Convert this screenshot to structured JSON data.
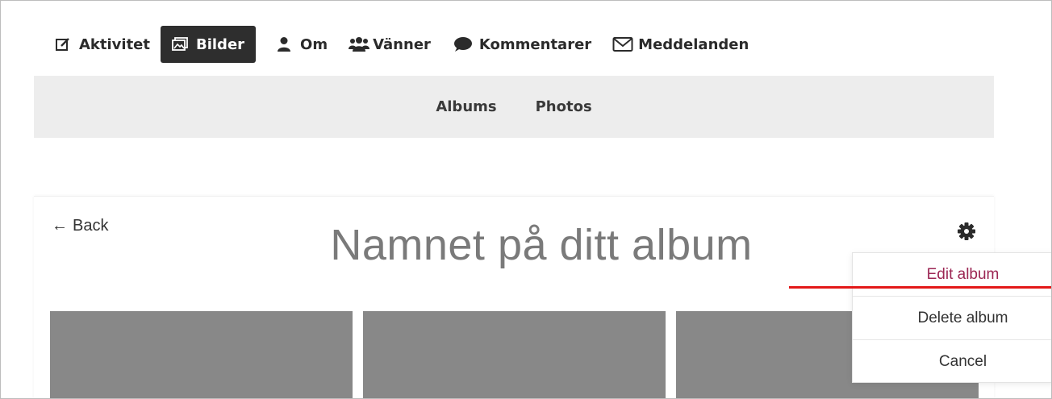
{
  "nav": {
    "items": [
      {
        "label": "Aktivitet",
        "icon": "edit-icon"
      },
      {
        "label": "Bilder",
        "icon": "images-icon",
        "active": true
      },
      {
        "label": "Om",
        "icon": "user-icon"
      },
      {
        "label": "Vänner",
        "icon": "users-icon"
      },
      {
        "label": "Kommentarer",
        "icon": "comment-icon"
      },
      {
        "label": "Meddelanden",
        "icon": "envelope-icon"
      }
    ]
  },
  "subnav": {
    "tabs": [
      {
        "label": "Albums"
      },
      {
        "label": "Photos"
      }
    ]
  },
  "album": {
    "back_arrow": "←",
    "back_label": "Back",
    "title": "Namnet på ditt album",
    "photo_color": "#888888"
  },
  "menu": {
    "items": [
      {
        "label": "Edit album",
        "color": "#9c2754"
      },
      {
        "label": "Delete album"
      },
      {
        "label": "Cancel"
      }
    ]
  },
  "colors": {
    "active_tab_bg": "#2e2e2e",
    "subnav_bg": "#ededed",
    "highlight_line": "#e31818"
  }
}
